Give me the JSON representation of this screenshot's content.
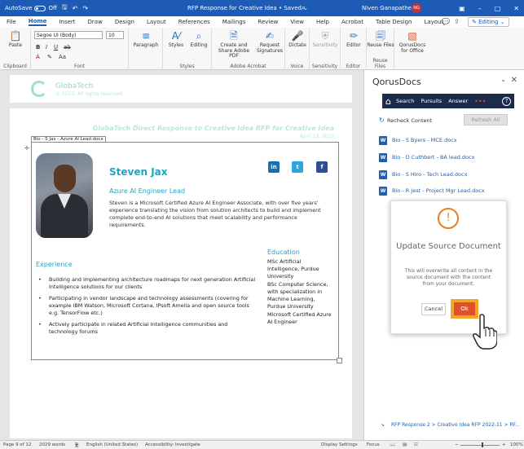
{
  "titlebar": {
    "autosave": "AutoSave",
    "autosave_state": "Off",
    "doc_title": "RFP Response for Creative Idea",
    "saved": "Saved",
    "user": "Niven Ganapathee",
    "user_initials": "NG"
  },
  "tabs": [
    "File",
    "Home",
    "Insert",
    "Draw",
    "Design",
    "Layout",
    "References",
    "Mailings",
    "Review",
    "View",
    "Help",
    "Acrobat",
    "Table Design",
    "Layout"
  ],
  "active_tab": "Home",
  "editing_label": "Editing",
  "ribbon": {
    "clipboard_group": "Clipboard",
    "paste": "Paste",
    "font_name": "Segoe UI (Body)",
    "font_size": "10",
    "font_group": "Font",
    "paragraph": "Paragraph",
    "styles": "Styles",
    "editing": "Editing",
    "styles_group": "Styles",
    "create_share": "Create and Share Adobe PDF",
    "request_sig": "Request Signatures",
    "adobe_group": "Adobe Acrobat",
    "dictate": "Dictate",
    "voice_group": "Voice",
    "sensitivity": "Sensitivity",
    "sensitivity_group": "Sensitivity",
    "editor": "Editor",
    "editor_group": "Editor",
    "reuse": "Reuse Files",
    "reuse_group": "Reuse Files",
    "qorus": "QorusDocs for Office"
  },
  "doc": {
    "logo_name": "GlobaTech",
    "logo_copy": "© 2020. All rights reserved.",
    "heading": "GlobaTech Direct Response to Creative Idea RFP for Creative Idea",
    "date": "April 13, 2022",
    "cc_tag": "Bio - S Jax - Azure AI Lead.docx",
    "name": "Steven Jax",
    "role": "Azure AI Engineer Lead",
    "bio": "Steven is a Microsoft Certified Azure AI Engineer Associate, with over five years' experience translating the vision from solution architects to build and implement complete end-to-end AI solutions that meet scalability and performance requirements.",
    "experience_title": "Experience",
    "experience": [
      "Building and implementing architecture roadmaps for next generation Artificial Intelligence solutions for our clients",
      "Participating in vendor landscape and technology assessments (covering for example IBM Watson, Microsoft Cortana, IPsoft Amelia and open source tools e.g. TensorFlow etc.)",
      "Actively participate in related Artificial Intelligence communities and technology forums"
    ],
    "education_title": "Education",
    "education": [
      "MSc Artificial Intelligence, Purdue University",
      "BSc Computer Science, with specialization in Machine Learning, Purdue University",
      "Microsoft Certified Azure AI Engineer"
    ],
    "social": [
      "in",
      "t",
      "f"
    ]
  },
  "pane": {
    "title": "QorusDocs",
    "nav": [
      "Search",
      "Pursuits",
      "Answer"
    ],
    "nav_more": "•••",
    "recheck": "Recheck Content",
    "refresh_all": "Refresh All",
    "docs": [
      "Bio - S Byers - MCE.docx",
      "Bio - D Cuthbert - BA lead.docx",
      "Bio - S Hiro - Tech Lead.docx",
      "Bio - R Jest - Project Mgr Lead.docx"
    ],
    "modal": {
      "title": "Update Source Document",
      "message": "This will overwrite all content in the source document with the content from your document.",
      "cancel": "Cancel",
      "ok": "Ok"
    },
    "footer": "RFP Response 2 > Creative Idea RFP 2022-11 > RF..."
  },
  "status": {
    "page": "Page 9 of 12",
    "words": "2029 words",
    "language": "English (United States)",
    "accessibility": "Accessibility: Investigate",
    "display": "Display Settings",
    "focus": "Focus",
    "zoom": "100%",
    "zoom_fraction": 0.55
  },
  "colors": {
    "word_blue": "#1d5bb5",
    "accent_teal": "#1ea4c6",
    "ok_orange": "#e0502b",
    "ok_highlight": "#f4a62a"
  }
}
